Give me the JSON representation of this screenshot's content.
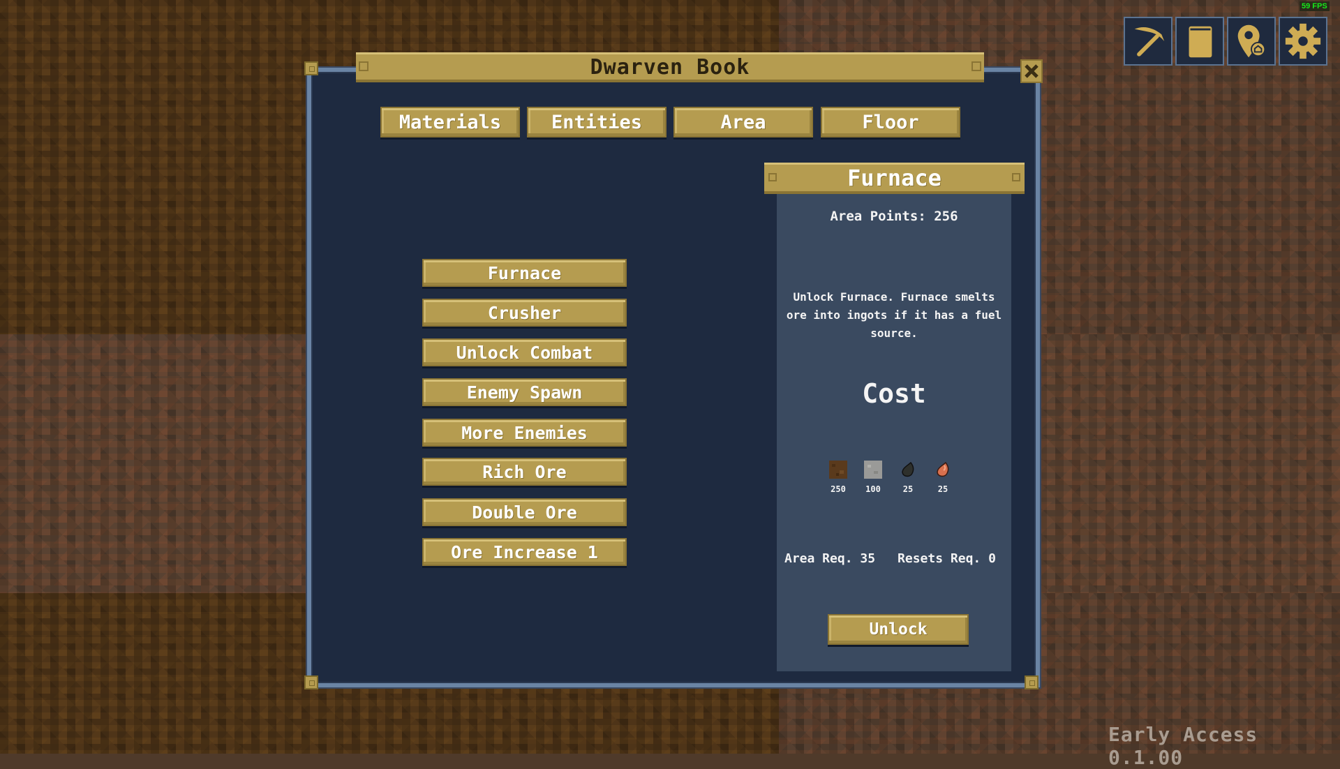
{
  "hud": {
    "fps": "59 FPS",
    "toolbar": [
      {
        "name": "pickaxe-icon",
        "label": "Mining"
      },
      {
        "name": "book-icon",
        "label": "Dwarven Book"
      },
      {
        "name": "map-pin-home-icon",
        "label": "Locations"
      },
      {
        "name": "gear-icon",
        "label": "Settings"
      }
    ],
    "version": "Early Access 0.1.00"
  },
  "dialog": {
    "title": "Dwarven Book",
    "close_icon": "close-icon",
    "tabs": [
      {
        "label": "Materials"
      },
      {
        "label": "Entities"
      },
      {
        "label": "Area",
        "active": true
      },
      {
        "label": "Floor"
      }
    ],
    "upgrades": [
      {
        "label": "Furnace",
        "selected": true
      },
      {
        "label": "Crusher"
      },
      {
        "label": "Unlock Combat"
      },
      {
        "label": "Enemy Spawn"
      },
      {
        "label": "More Enemies"
      },
      {
        "label": "Rich Ore"
      },
      {
        "label": "Double Ore"
      },
      {
        "label": "Ore Increase 1"
      }
    ],
    "detail": {
      "title": "Furnace",
      "area_points": "Area Points: 256",
      "description": "Unlock Furnace. Furnace smelts ore into ingots if it has a fuel source.",
      "cost_title": "Cost",
      "costs": [
        {
          "icon": "dirt-block-icon",
          "qty": "250",
          "color": "#5a3a1c"
        },
        {
          "icon": "stone-block-icon",
          "qty": "100",
          "color": "#9a9a98"
        },
        {
          "icon": "coal-ore-icon",
          "qty": "25",
          "color": "#2e302c"
        },
        {
          "icon": "copper-ore-icon",
          "qty": "25",
          "color": "#d8704e"
        }
      ],
      "area_req": "Area Req. 35",
      "resets_req": "Resets Req. 0",
      "unlock_label": "Unlock"
    }
  },
  "colors": {
    "gold": "#b59c50",
    "panel": "#1e2a40",
    "detail_panel": "#3a4a60",
    "frame": "#6a84a4",
    "fps_green": "#17e81a"
  }
}
